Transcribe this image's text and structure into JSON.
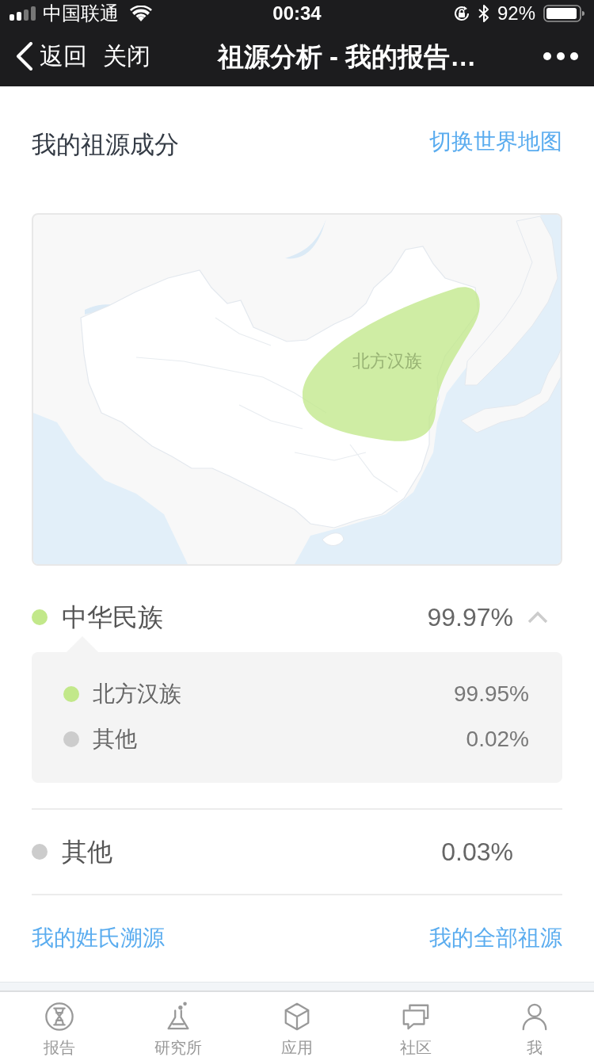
{
  "status_bar": {
    "carrier": "中国联通",
    "time": "00:34",
    "battery": "92%"
  },
  "nav_bar": {
    "back": "返回",
    "close": "关闭",
    "title": "祖源分析 - 我的报告…"
  },
  "ancestry": {
    "title": "我的祖源成分",
    "switch_link": "切换世界地图",
    "map": {
      "region_label": "北方汉族"
    },
    "groups": [
      {
        "name": "中华民族",
        "percent": "99.97%",
        "color": "#c2e88a",
        "expanded": true,
        "children": [
          {
            "name": "北方汉族",
            "percent": "99.95%",
            "color": "#c2e88a"
          },
          {
            "name": "其他",
            "percent": "0.02%",
            "color": "#cccccc"
          }
        ]
      },
      {
        "name": "其他",
        "percent": "0.03%",
        "color": "#cccccc",
        "expanded": false
      }
    ],
    "links": [
      "我的姓氏溯源",
      "我的全部祖源"
    ]
  },
  "tab_bar": [
    {
      "label": "报告",
      "selected": false
    },
    {
      "label": "研究所",
      "selected": false
    },
    {
      "label": "应用",
      "selected": false
    },
    {
      "label": "社区",
      "selected": false
    },
    {
      "label": "我",
      "selected": false
    }
  ]
}
